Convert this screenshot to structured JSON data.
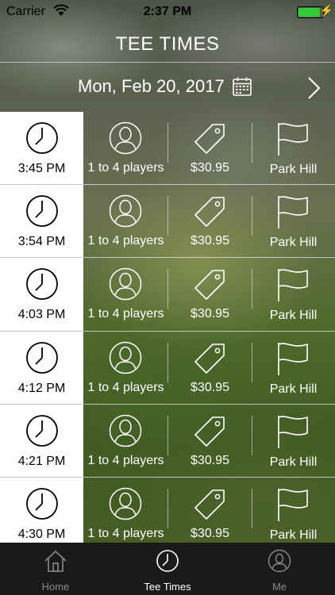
{
  "status_bar": {
    "carrier": "Carrier",
    "time": "2:37 PM",
    "battery_level": 0.92
  },
  "header": {
    "title": "TEE TIMES"
  },
  "date_nav": {
    "date": "Mon, Feb 20, 2017",
    "calendar_icon": "calendar-icon",
    "next_icon": "chevron-right-icon"
  },
  "tee_times": [
    {
      "time": "3:45 PM",
      "players": "1 to 4 players",
      "price": "$30.95",
      "course": "Park Hill"
    },
    {
      "time": "3:54 PM",
      "players": "1 to 4 players",
      "price": "$30.95",
      "course": "Park Hill"
    },
    {
      "time": "4:03 PM",
      "players": "1 to 4 players",
      "price": "$30.95",
      "course": "Park Hill"
    },
    {
      "time": "4:12 PM",
      "players": "1 to 4 players",
      "price": "$30.95",
      "course": "Park Hill"
    },
    {
      "time": "4:21 PM",
      "players": "1 to 4 players",
      "price": "$30.95",
      "course": "Park Hill"
    },
    {
      "time": "4:30 PM",
      "players": "1 to 4 players",
      "price": "$30.95",
      "course": "Park Hill"
    }
  ],
  "tab_bar": {
    "tabs": [
      {
        "label": "Home",
        "icon": "home-icon",
        "active": false
      },
      {
        "label": "Tee Times",
        "icon": "clock-icon",
        "active": true
      },
      {
        "label": "Me",
        "icon": "person-icon",
        "active": false
      }
    ]
  },
  "colors": {
    "accent_active": "#ffffff",
    "tab_inactive": "#8a8a8a",
    "battery": "#35c935"
  }
}
